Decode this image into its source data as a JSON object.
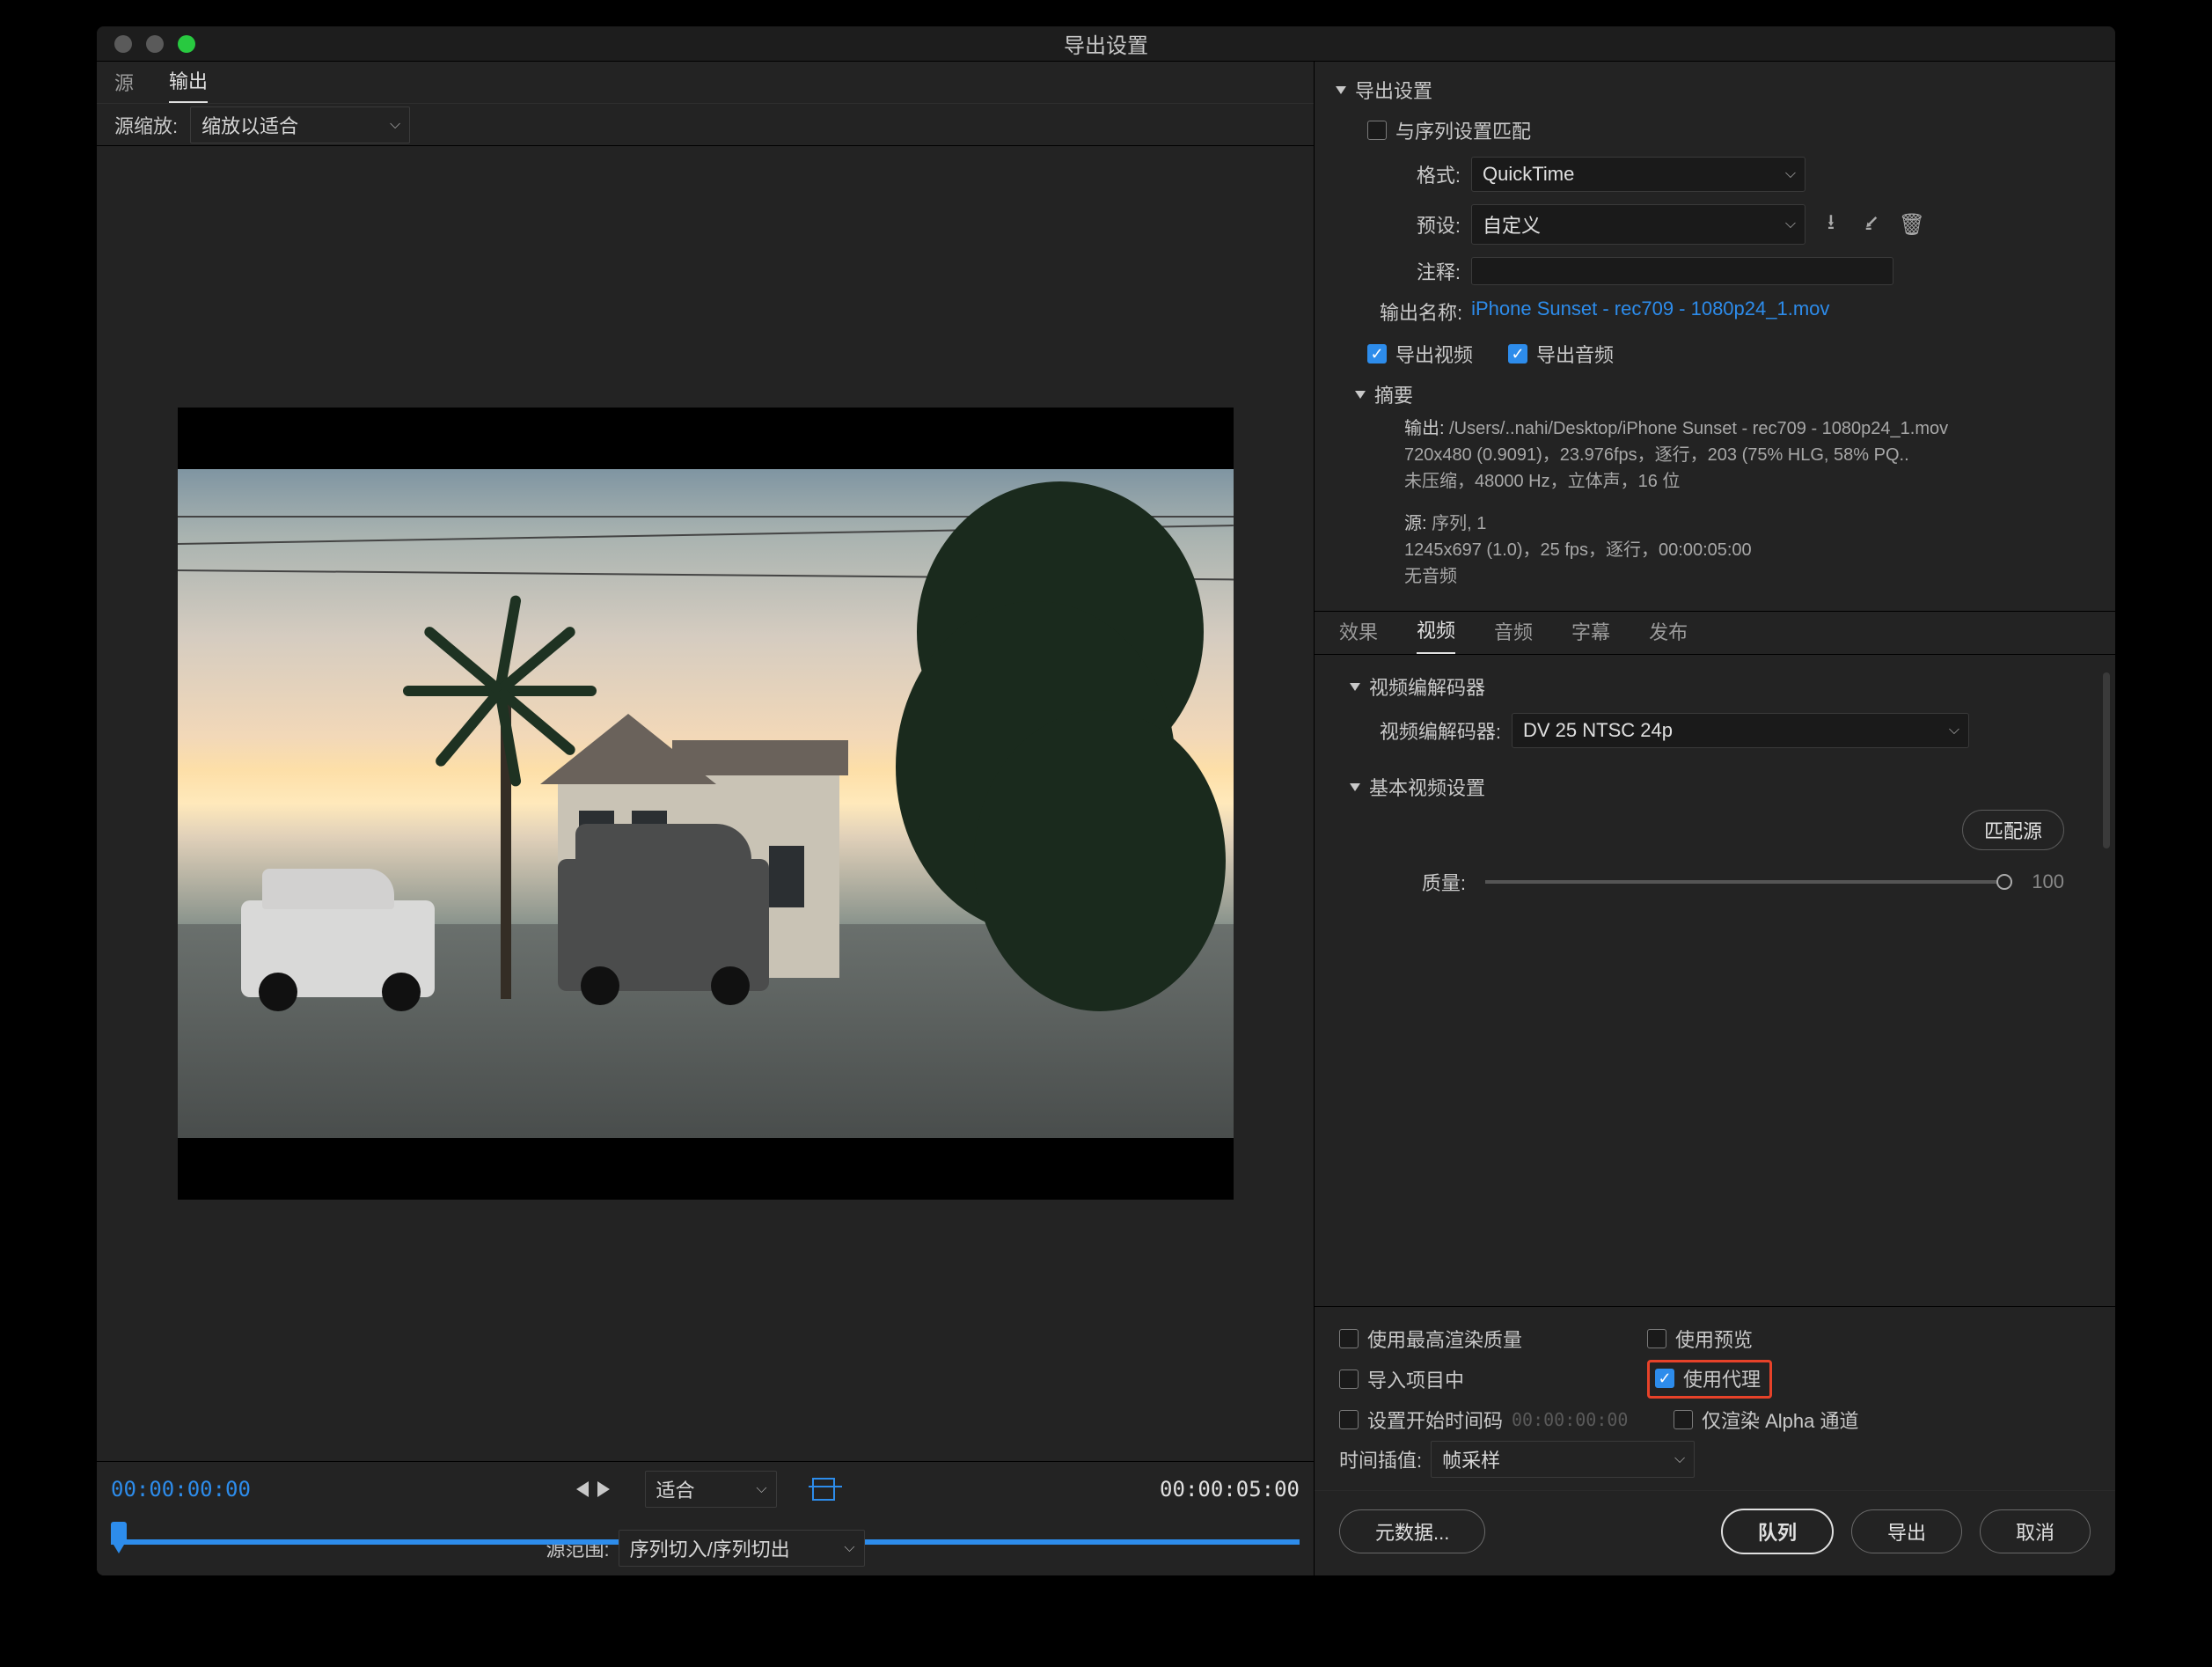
{
  "title": "导出设置",
  "left": {
    "tabs": {
      "source": "源",
      "output": "输出"
    },
    "scale_label": "源缩放:",
    "scale_value": "缩放以适合",
    "time": {
      "in": "00:00:00:00",
      "out": "00:00:05:00",
      "fit": "适合"
    },
    "range_label": "源范围:",
    "range_value": "序列切入/序列切出"
  },
  "export": {
    "header": "导出设置",
    "match_sequence": "与序列设置匹配",
    "format_label": "格式:",
    "format_value": "QuickTime",
    "preset_label": "预设:",
    "preset_value": "自定义",
    "comment_label": "注释:",
    "outputname_label": "输出名称:",
    "outputname_value": "iPhone Sunset - rec709 - 1080p24_1.mov",
    "export_video": "导出视频",
    "export_audio": "导出音频"
  },
  "summary": {
    "header": "摘要",
    "out_label": "输出:",
    "out_line1": "/Users/..nahi/Desktop/iPhone Sunset - rec709 - 1080p24_1.mov",
    "out_line2": "720x480 (0.9091)，23.976fps，逐行，203 (75% HLG, 58% PQ..",
    "out_line3": "未压缩，48000 Hz，立体声，16 位",
    "src_label": "源:",
    "src_line1": "序列, 1",
    "src_line2": "1245x697 (1.0)，25 fps，逐行，00:00:05:00",
    "src_line3": "无音频"
  },
  "tabs": {
    "effects": "效果",
    "video": "视频",
    "audio": "音频",
    "caption": "字幕",
    "publish": "发布"
  },
  "video": {
    "codec_header": "视频编解码器",
    "codec_label": "视频编解码器:",
    "codec_value": "DV 25 NTSC 24p",
    "basic_header": "基本视频设置",
    "match_source_btn": "匹配源",
    "quality_label": "质量:",
    "quality_value": "100"
  },
  "opts": {
    "max_render": "使用最高渲染质量",
    "use_preview": "使用预览",
    "import_project": "导入项目中",
    "use_proxy": "使用代理",
    "set_tc": "设置开始时间码",
    "tc_value": "00:00:00:00",
    "render_alpha": "仅渲染 Alpha 通道",
    "interp_label": "时间插值:",
    "interp_value": "帧采样"
  },
  "buttons": {
    "metadata": "元数据...",
    "queue": "队列",
    "export": "导出",
    "cancel": "取消"
  }
}
